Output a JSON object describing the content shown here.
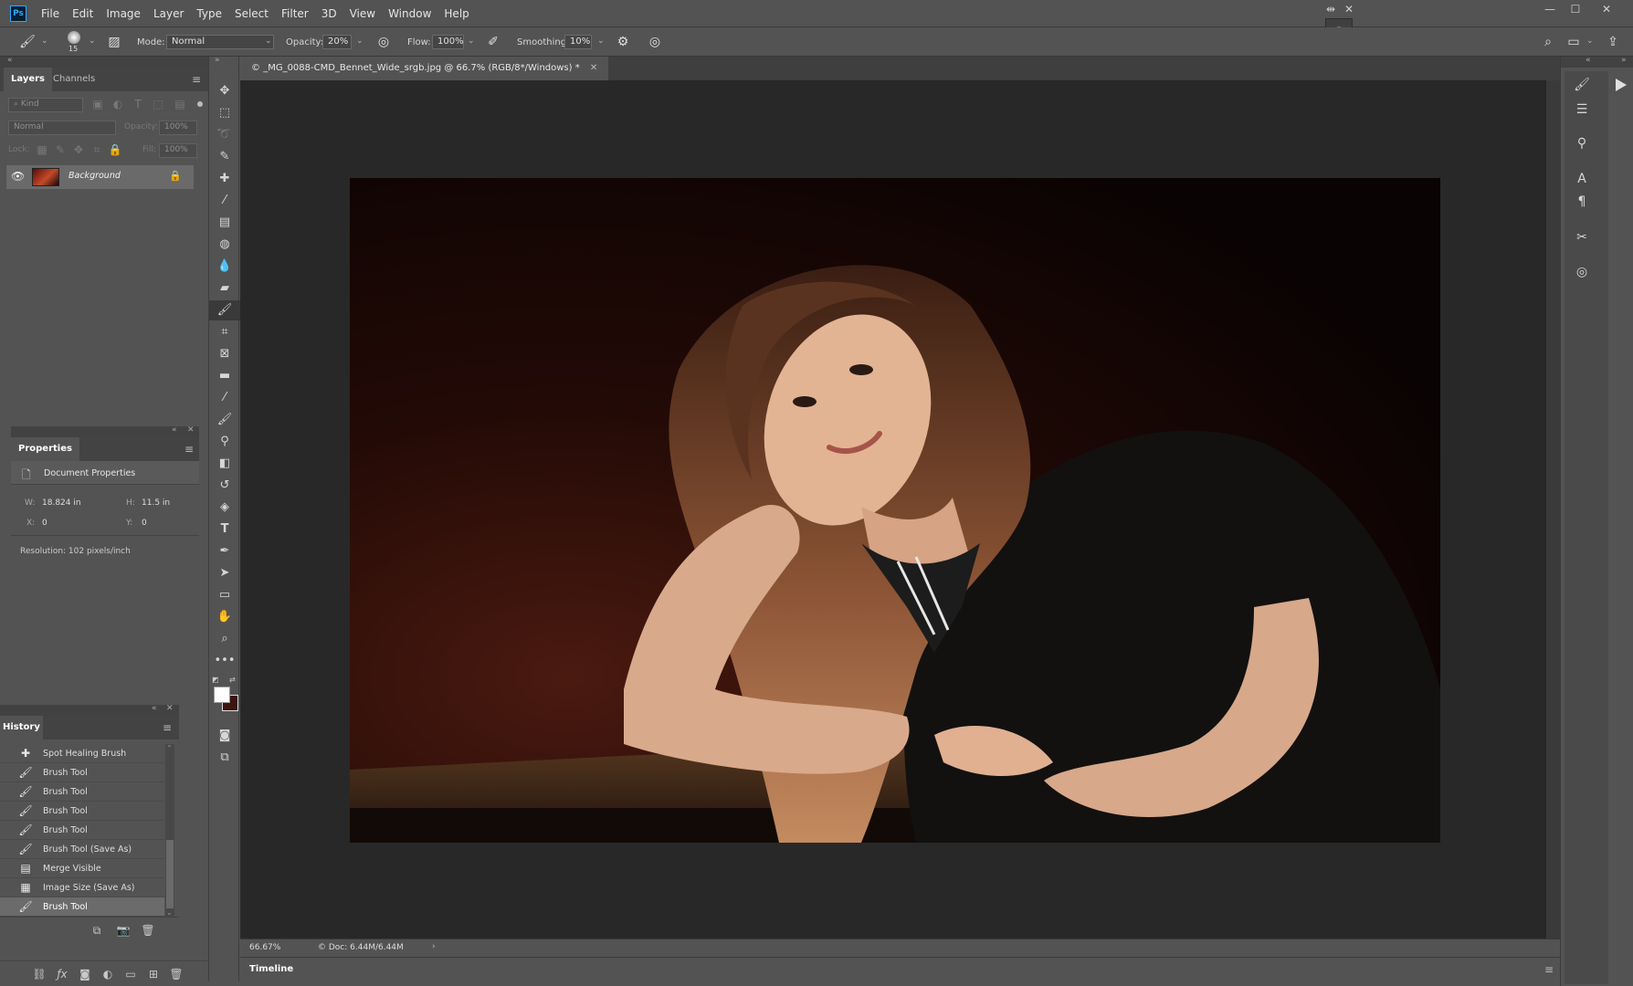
{
  "app": {
    "logo": "Ps"
  },
  "menu": [
    "File",
    "Edit",
    "Image",
    "Layer",
    "Type",
    "Select",
    "Filter",
    "3D",
    "View",
    "Window",
    "Help"
  ],
  "options": {
    "brush_size": "15",
    "mode_label": "Mode:",
    "mode_value": "Normal",
    "opacity_label": "Opacity:",
    "opacity_value": "20%",
    "flow_label": "Flow:",
    "flow_value": "100%",
    "smoothing_label": "Smoothing:",
    "smoothing_value": "10%"
  },
  "layers_panel": {
    "tabs": [
      "Layers",
      "Channels"
    ],
    "kind_placeholder": "Kind",
    "blend_mode": "Normal",
    "opacity_label": "Opacity:",
    "opacity_value": "100%",
    "lock_label": "Lock:",
    "fill_label": "Fill:",
    "fill_value": "100%",
    "layers": [
      {
        "name": "Background",
        "visible": true,
        "locked": true
      }
    ]
  },
  "properties_panel": {
    "title": "Properties",
    "section": "Document Properties",
    "w_label": "W:",
    "w_value": "18.824 in",
    "h_label": "H:",
    "h_value": "11.5 in",
    "x_label": "X:",
    "x_value": "0",
    "y_label": "Y:",
    "y_value": "0",
    "resolution": "Resolution: 102 pixels/inch"
  },
  "history_panel": {
    "title": "History",
    "items": [
      {
        "label": "Spot Healing Brush",
        "icon": "spot-healing-icon"
      },
      {
        "label": "Brush Tool",
        "icon": "brush-icon"
      },
      {
        "label": "Brush Tool",
        "icon": "brush-icon"
      },
      {
        "label": "Brush Tool",
        "icon": "brush-icon"
      },
      {
        "label": "Brush Tool",
        "icon": "brush-icon"
      },
      {
        "label": "Brush Tool (Save As)",
        "icon": "brush-icon"
      },
      {
        "label": "Merge Visible",
        "icon": "merge-icon"
      },
      {
        "label": "Image Size (Save As)",
        "icon": "image-size-icon"
      },
      {
        "label": "Brush Tool",
        "icon": "brush-icon",
        "current": true
      }
    ]
  },
  "document": {
    "tab_title": "_MG_0088-CMD_Bennet_Wide_srgb.jpg @ 66.7% (RGB/8*/Windows) *"
  },
  "status": {
    "zoom": "66.67%",
    "doc_size": "Doc: 6.44M/6.44M"
  },
  "timeline": {
    "label": "Timeline"
  }
}
